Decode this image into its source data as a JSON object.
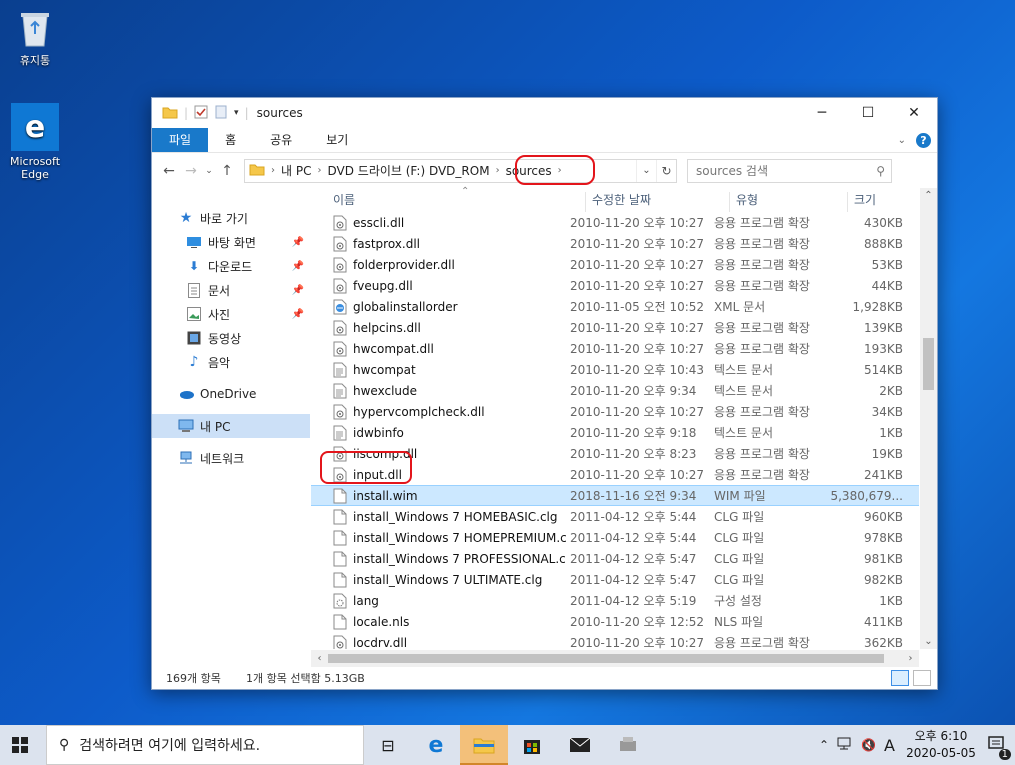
{
  "desktop": {
    "icons": [
      {
        "label": "휴지통"
      },
      {
        "label": "Microsoft Edge"
      }
    ]
  },
  "window": {
    "title": "sources",
    "controls": {
      "minimize": "─",
      "maximize": "☐",
      "close": "✕"
    },
    "ribbon_tabs": [
      "파일",
      "홈",
      "공유",
      "보기"
    ],
    "address": {
      "crumbs": [
        "내 PC",
        "DVD 드라이브 (F:) DVD_ROM",
        "sources"
      ]
    },
    "search": {
      "placeholder": "sources 검색"
    },
    "nav": {
      "quick_access": "바로 가기",
      "quick_items": [
        "바탕 화면",
        "다운로드",
        "문서",
        "사진",
        "동영상",
        "음악"
      ],
      "onedrive": "OneDrive",
      "this_pc": "내 PC",
      "network": "네트워크"
    },
    "columns": {
      "name": "이름",
      "date": "수정한 날짜",
      "type": "유형",
      "size": "크기"
    },
    "files": [
      {
        "name": "esscli.dll",
        "date": "2010-11-20 오후 10:27",
        "type": "응용 프로그램 확장",
        "size": "430KB",
        "icon": "dll"
      },
      {
        "name": "fastprox.dll",
        "date": "2010-11-20 오후 10:27",
        "type": "응용 프로그램 확장",
        "size": "888KB",
        "icon": "dll"
      },
      {
        "name": "folderprovider.dll",
        "date": "2010-11-20 오후 10:27",
        "type": "응용 프로그램 확장",
        "size": "53KB",
        "icon": "dll"
      },
      {
        "name": "fveupg.dll",
        "date": "2010-11-20 오후 10:27",
        "type": "응용 프로그램 확장",
        "size": "44KB",
        "icon": "dll"
      },
      {
        "name": "globalinstallorder",
        "date": "2010-11-05 오전 10:52",
        "type": "XML 문서",
        "size": "1,928KB",
        "icon": "xml"
      },
      {
        "name": "helpcins.dll",
        "date": "2010-11-20 오후 10:27",
        "type": "응용 프로그램 확장",
        "size": "139KB",
        "icon": "dll"
      },
      {
        "name": "hwcompat.dll",
        "date": "2010-11-20 오후 10:27",
        "type": "응용 프로그램 확장",
        "size": "193KB",
        "icon": "dll"
      },
      {
        "name": "hwcompat",
        "date": "2010-11-20 오후 10:43",
        "type": "텍스트 문서",
        "size": "514KB",
        "icon": "txt"
      },
      {
        "name": "hwexclude",
        "date": "2010-11-20 오후 9:34",
        "type": "텍스트 문서",
        "size": "2KB",
        "icon": "txt"
      },
      {
        "name": "hypervcomplcheck.dll",
        "date": "2010-11-20 오후 10:27",
        "type": "응용 프로그램 확장",
        "size": "34KB",
        "icon": "dll"
      },
      {
        "name": "idwbinfo",
        "date": "2010-11-20 오후 9:18",
        "type": "텍스트 문서",
        "size": "1KB",
        "icon": "txt"
      },
      {
        "name": "iiscomp.dll",
        "date": "2010-11-20 오후 8:23",
        "type": "응용 프로그램 확장",
        "size": "19KB",
        "icon": "dll"
      },
      {
        "name": "input.dll",
        "date": "2010-11-20 오후 10:27",
        "type": "응용 프로그램 확장",
        "size": "241KB",
        "icon": "dll"
      },
      {
        "name": "install.wim",
        "date": "2018-11-16 오전 9:34",
        "type": "WIM 파일",
        "size": "5,380,679...",
        "icon": "file",
        "selected": true
      },
      {
        "name": "install_Windows 7 HOMEBASIC.clg",
        "date": "2011-04-12 오후 5:44",
        "type": "CLG 파일",
        "size": "960KB",
        "icon": "file"
      },
      {
        "name": "install_Windows 7 HOMEPREMIUM.clg",
        "date": "2011-04-12 오후 5:44",
        "type": "CLG 파일",
        "size": "978KB",
        "icon": "file"
      },
      {
        "name": "install_Windows 7 PROFESSIONAL.clg",
        "date": "2011-04-12 오후 5:47",
        "type": "CLG 파일",
        "size": "981KB",
        "icon": "file"
      },
      {
        "name": "install_Windows 7 ULTIMATE.clg",
        "date": "2011-04-12 오후 5:47",
        "type": "CLG 파일",
        "size": "982KB",
        "icon": "file"
      },
      {
        "name": "lang",
        "date": "2011-04-12 오후 5:19",
        "type": "구성 설정",
        "size": "1KB",
        "icon": "ini"
      },
      {
        "name": "locale.nls",
        "date": "2010-11-20 오후 12:52",
        "type": "NLS 파일",
        "size": "411KB",
        "icon": "file"
      },
      {
        "name": "locdrv.dll",
        "date": "2010-11-20 오후 10:27",
        "type": "응용 프로그램 확장",
        "size": "362KB",
        "icon": "dll"
      }
    ],
    "status": {
      "count": "169개 항목",
      "selection": "1개 항목 선택함 5.13GB"
    }
  },
  "taskbar": {
    "search_placeholder": "검색하려면 여기에 입력하세요.",
    "ime": "A",
    "time": "오후 6:10",
    "date": "2020-05-05",
    "notification_count": "1"
  },
  "colors": {
    "accent": "#1979ca",
    "highlight_oval": "#e3151b",
    "selection": "#cce8ff"
  }
}
